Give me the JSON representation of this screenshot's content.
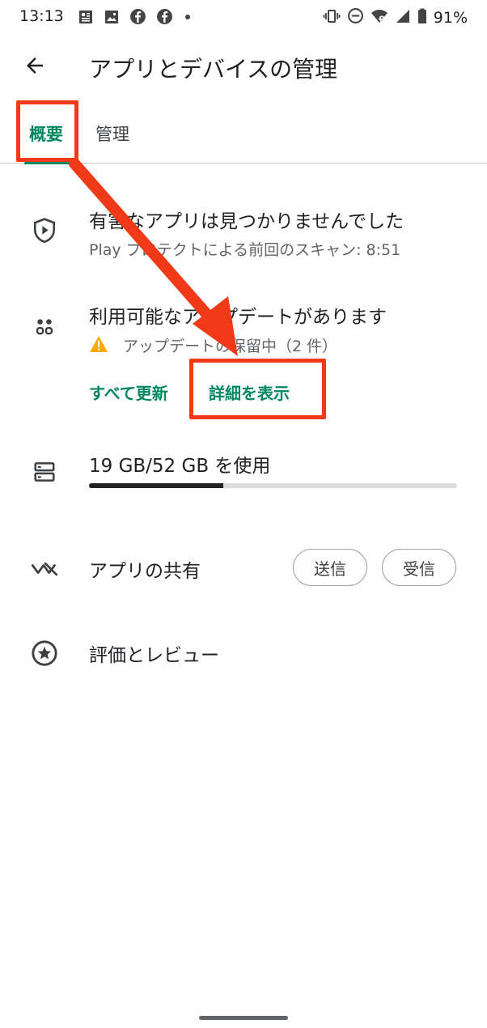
{
  "status_bar": {
    "time": "13:13",
    "battery": "91%",
    "left_icons": [
      "news-icon",
      "image-icon",
      "facebook-icon",
      "facebook-icon",
      "dot-icon"
    ],
    "right_icons": [
      "vibrate-icon",
      "do-not-disturb-icon",
      "wifi-icon",
      "signal-icon",
      "battery-icon"
    ]
  },
  "app_bar": {
    "title": "アプリとデバイスの管理",
    "back_icon": "arrow-back-icon"
  },
  "tabs": [
    {
      "label": "概要",
      "selected": true
    },
    {
      "label": "管理",
      "selected": false
    }
  ],
  "protect": {
    "icon": "play-protect-shield-icon",
    "title": "有害なアプリは見つかりませんでした",
    "subtitle": "Play プロテクトによる前回のスキャン: 8:51"
  },
  "updates": {
    "icon": "apps-dots-icon",
    "title": "利用可能なアップデートがあります",
    "warning_icon": "warning-icon",
    "pending": "アップデートの保留中（2 件）",
    "update_all": "すべて更新",
    "show_details": "詳細を表示"
  },
  "storage": {
    "icon": "storage-icon",
    "label": "19 GB/52 GB を使用",
    "used_fraction": 0.365
  },
  "share": {
    "icon": "nearby-share-icon",
    "label": "アプリの共有",
    "send": "送信",
    "receive": "受信"
  },
  "ratings": {
    "icon": "star-circle-icon",
    "label": "評価とレビュー"
  },
  "colors": {
    "accent": "#01875f",
    "annotation": "#f03a17",
    "warning": "#f9ab00"
  }
}
